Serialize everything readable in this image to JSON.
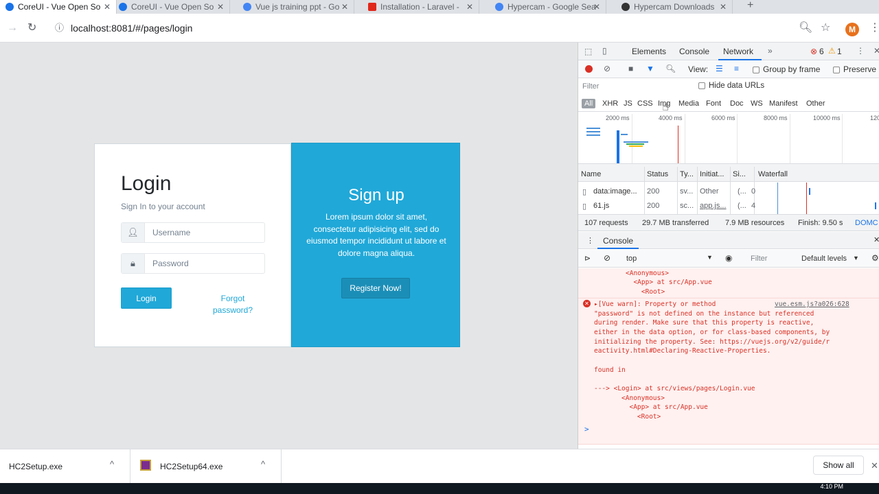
{
  "tabs": [
    {
      "label": "CoreUI - Vue Open So",
      "active": true
    },
    {
      "label": "CoreUI - Vue Open So",
      "active": false
    },
    {
      "label": "Vue js training ppt - Go",
      "active": false
    },
    {
      "label": "Installation - Laravel - ",
      "active": false
    },
    {
      "label": "Hypercam - Google Sea",
      "active": false
    },
    {
      "label": "Hypercam Downloads",
      "active": false
    }
  ],
  "address_bar": {
    "url": "localhost:8081/#/pages/login"
  },
  "profile": {
    "initial": "M",
    "color": "#e8711c"
  },
  "login": {
    "title": "Login",
    "subtitle": "Sign In to your account",
    "username_placeholder": "Username",
    "password_placeholder": "Password",
    "login_button": "Login",
    "forgot_link": "Forgot password?"
  },
  "signup": {
    "title": "Sign up",
    "text": "Lorem ipsum dolor sit amet, consectetur adipisicing elit, sed do eiusmod tempor incididunt ut labore et dolore magna aliqua.",
    "register_button": "Register Now!",
    "color": "#20a8d8"
  },
  "devtools": {
    "tabs": [
      "Elements",
      "Console",
      "Network"
    ],
    "active_tab": "Network",
    "errors": "6",
    "warnings": "1",
    "view_label": "View:",
    "group_by_frame": "Group by frame",
    "preserve_log": "Preserve",
    "filter_placeholder": "Filter",
    "hide_data_urls": "Hide data URLs",
    "filter_types": [
      "All",
      "XHR",
      "JS",
      "CSS",
      "Img",
      "Media",
      "Font",
      "Doc",
      "WS",
      "Manifest",
      "Other"
    ],
    "ticks": [
      "2000 ms",
      "4000 ms",
      "6000 ms",
      "8000 ms",
      "10000 ms",
      "120"
    ],
    "columns": [
      "Name",
      "Status",
      "Ty...",
      "Initiat...",
      "Si...",
      "Waterfall"
    ],
    "rows": [
      {
        "name": "data:image...",
        "status": "200",
        "type": "sv...",
        "initiator": "Other",
        "size_a": "(...",
        "size_b": "0"
      },
      {
        "name": "61.js",
        "status": "200",
        "type": "sc...",
        "initiator": "app.js...",
        "size_a": "(...",
        "size_b": "4"
      }
    ],
    "summary": [
      "107 requests",
      "29.7 MB transferred",
      "7.9 MB resources",
      "Finish: 9.50 s",
      "DOMC"
    ],
    "drawer_tab": "Console",
    "context": "top",
    "console_filter": "Filter",
    "levels": "Default levels",
    "console_lines_top": [
      "<Anonymous>",
      "  <App> at src/App.vue",
      "    <Root>"
    ],
    "error_source": "vue.esm.js?a026:628",
    "error_lines": [
      "▸[Vue warn]: Property or method",
      "\"password\" is not defined on the instance but referenced",
      "during render. Make sure that this property is reactive,",
      "either in the data option, or for class-based components, by",
      "initializing the property. See: https://vuejs.org/v2/guide/r",
      "eactivity.html#Declaring-Reactive-Properties.",
      "",
      "found in",
      "",
      "---> <Login> at src/views/pages/Login.vue",
      "       <Anonymous>",
      "         <App> at src/App.vue",
      "           <Root>"
    ],
    "prompt": ">"
  },
  "downloads": [
    {
      "name": "HC2Setup.exe"
    },
    {
      "name": "HC2Setup64.exe"
    }
  ],
  "downloads_show_all": "Show all",
  "clock": "4:10 PM"
}
